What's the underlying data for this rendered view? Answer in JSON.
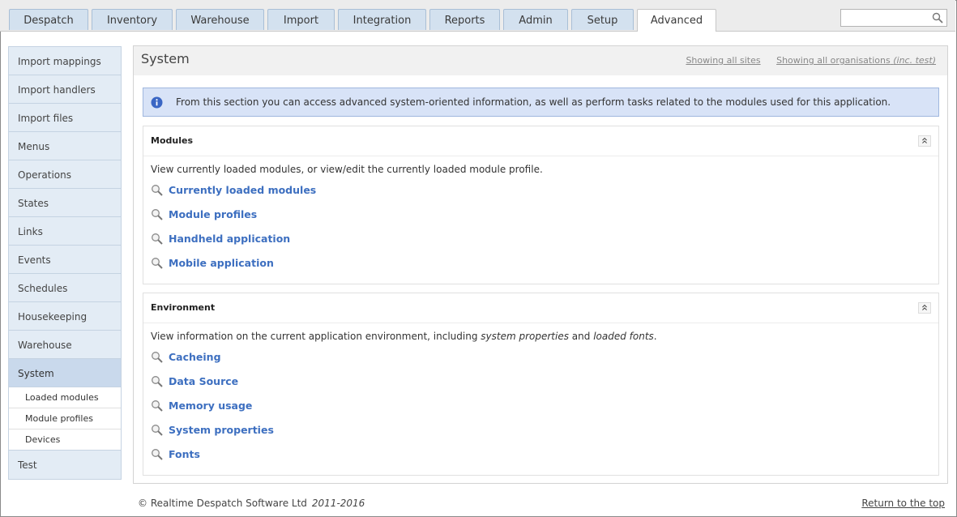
{
  "tabs": [
    {
      "label": "Despatch",
      "active": false
    },
    {
      "label": "Inventory",
      "active": false
    },
    {
      "label": "Warehouse",
      "active": false
    },
    {
      "label": "Import",
      "active": false
    },
    {
      "label": "Integration",
      "active": false
    },
    {
      "label": "Reports",
      "active": false
    },
    {
      "label": "Admin",
      "active": false
    },
    {
      "label": "Setup",
      "active": false
    },
    {
      "label": "Advanced",
      "active": true
    }
  ],
  "search": {
    "value": "",
    "placeholder": "",
    "icon": "search-icon"
  },
  "sidebar": {
    "items": [
      {
        "label": "Import mappings"
      },
      {
        "label": "Import handlers"
      },
      {
        "label": "Import files"
      },
      {
        "label": "Menus"
      },
      {
        "label": "Operations"
      },
      {
        "label": "States"
      },
      {
        "label": "Links"
      },
      {
        "label": "Events"
      },
      {
        "label": "Schedules"
      },
      {
        "label": "Housekeeping"
      },
      {
        "label": "Warehouse"
      },
      {
        "label": "System",
        "active": true
      }
    ],
    "subitems": [
      {
        "label": "Loaded modules"
      },
      {
        "label": "Module profiles"
      },
      {
        "label": "Devices"
      }
    ],
    "after": {
      "label": "Test"
    }
  },
  "main": {
    "title": "System",
    "header_link_sites": "Showing all sites",
    "header_link_orgs": "Showing all organisations",
    "header_link_orgs_note": "(inc. test)",
    "info": "From this section you can access advanced system-oriented information, as well as perform tasks related to the modules used for this application.",
    "modules": {
      "title": "Modules",
      "desc": "View currently loaded modules, or view/edit the currently loaded module profile.",
      "links": [
        {
          "label": "Currently loaded modules"
        },
        {
          "label": "Module profiles"
        },
        {
          "label": "Handheld application"
        },
        {
          "label": "Mobile application"
        }
      ]
    },
    "environment": {
      "title": "Environment",
      "desc_a": "View information on the current application environment, including ",
      "desc_b": "system properties",
      "desc_c": " and ",
      "desc_d": "loaded fonts",
      "desc_e": ".",
      "links": [
        {
          "label": "Cacheing"
        },
        {
          "label": "Data Source"
        },
        {
          "label": "Memory usage"
        },
        {
          "label": "System properties"
        },
        {
          "label": "Fonts"
        }
      ]
    }
  },
  "footer": {
    "copyright": "© Realtime Despatch Software Ltd",
    "years": "2011-2016",
    "return_top": "Return to the top"
  },
  "colors": {
    "link": "#3d6fc0",
    "tab": "#d3e1ef",
    "info_bg": "#d8e3f7"
  }
}
